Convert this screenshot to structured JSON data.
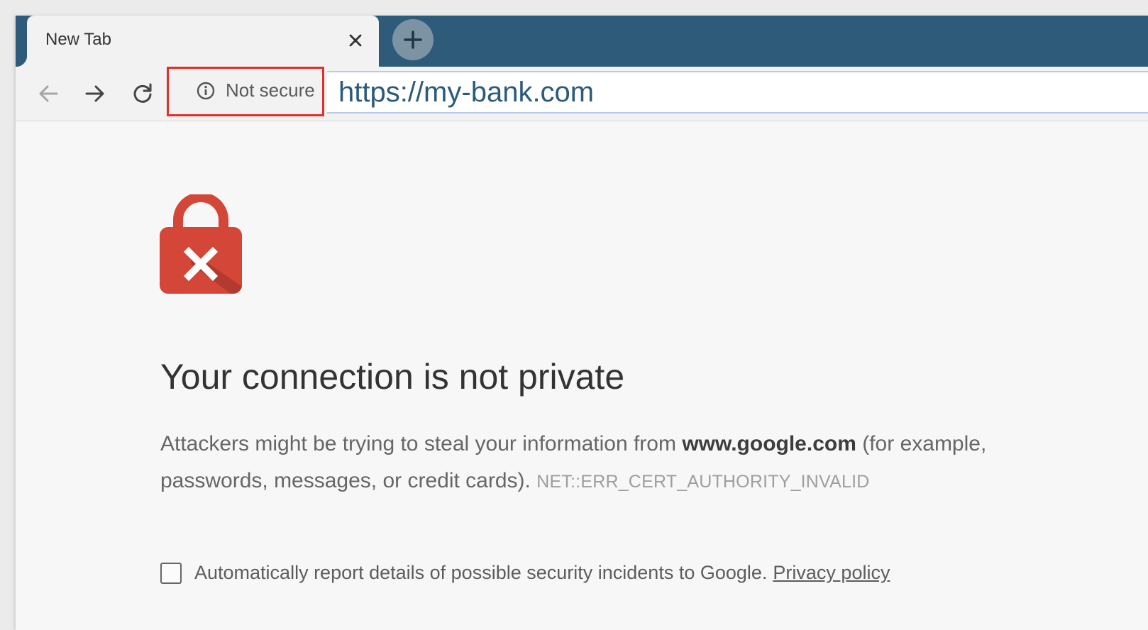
{
  "tab": {
    "title": "New Tab"
  },
  "icons": {
    "close": "close-icon",
    "new_tab": "plus-icon",
    "back": "arrow-left-icon",
    "forward": "arrow-right-icon",
    "reload": "reload-icon",
    "info": "info-icon",
    "lock": "broken-lock-icon"
  },
  "address_bar": {
    "security_label": "Not secure",
    "url": "https://my-bank.com"
  },
  "error_page": {
    "heading": "Your connection is not private",
    "description_part1": "Attackers might be trying to steal your information from",
    "domain": "www.google.com",
    "description_part2": "(for example, passwords, messages, or credit cards).",
    "error_code": "NET::ERR_CERT_AUTHORITY_INVALID",
    "report_text": "Automatically report details of possible security incidents to Google.",
    "privacy_link": "Privacy policy"
  },
  "colors": {
    "tabstrip": "#2e5b7a",
    "security_highlight": "#e0302a",
    "lock_red": "#d44638",
    "url_text": "#2b5a7b"
  }
}
